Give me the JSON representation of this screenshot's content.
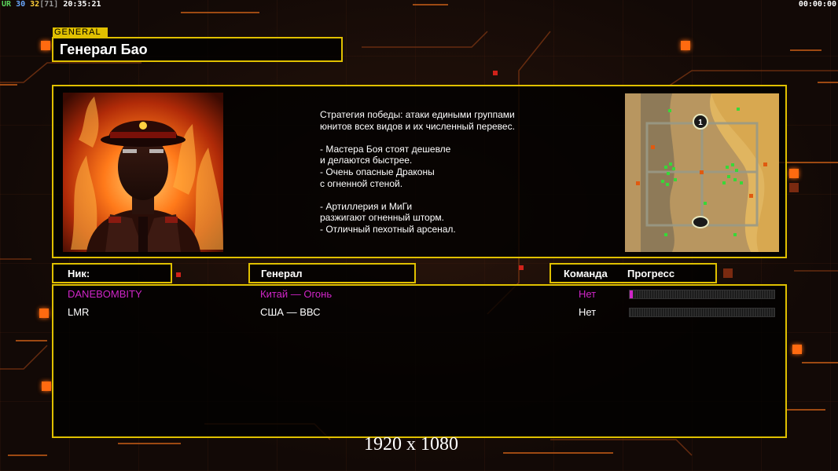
{
  "hud": {
    "left_ur": "UR",
    "left_fps": "30",
    "left_fps2": "32",
    "left_bracket": "[71]",
    "left_time": "20:35:21",
    "right_time": "00:00:00"
  },
  "header": {
    "tag": "GENERAL",
    "title": "Генерал Бао"
  },
  "info": {
    "description": "Стратегия победы: атаки едиными группами\nюнитов всех видов и их численный перевес.\n\n- Мастера Боя стоят дешевле\nи делаются быстрее.\n- Очень опасные Драконы\nс огненной стеной.\n\n- Артиллерия и МиГи\nразжигают огненный шторм.\n- Отличный пехотный арсенал.",
    "minimap_markers": [
      "1",
      ""
    ]
  },
  "table": {
    "col_nick": "Ник:",
    "col_general": "Генерал",
    "col_team": "Команда",
    "col_progress": "Прогресс"
  },
  "players": [
    {
      "nick": "DANEBOMBITY",
      "general": "Китай — Огонь",
      "team": "Нет",
      "progress": 0.02,
      "color": "#d025c8"
    },
    {
      "nick": "LMR",
      "general": "США — ВВС",
      "team": "Нет",
      "progress": 0,
      "color": "#ffffff"
    }
  ],
  "overlay": {
    "resolution": "1920 x 1080"
  },
  "colors": {
    "frame": "#e0c000",
    "accent": "#ff6a10",
    "player1": "#d025c8"
  }
}
